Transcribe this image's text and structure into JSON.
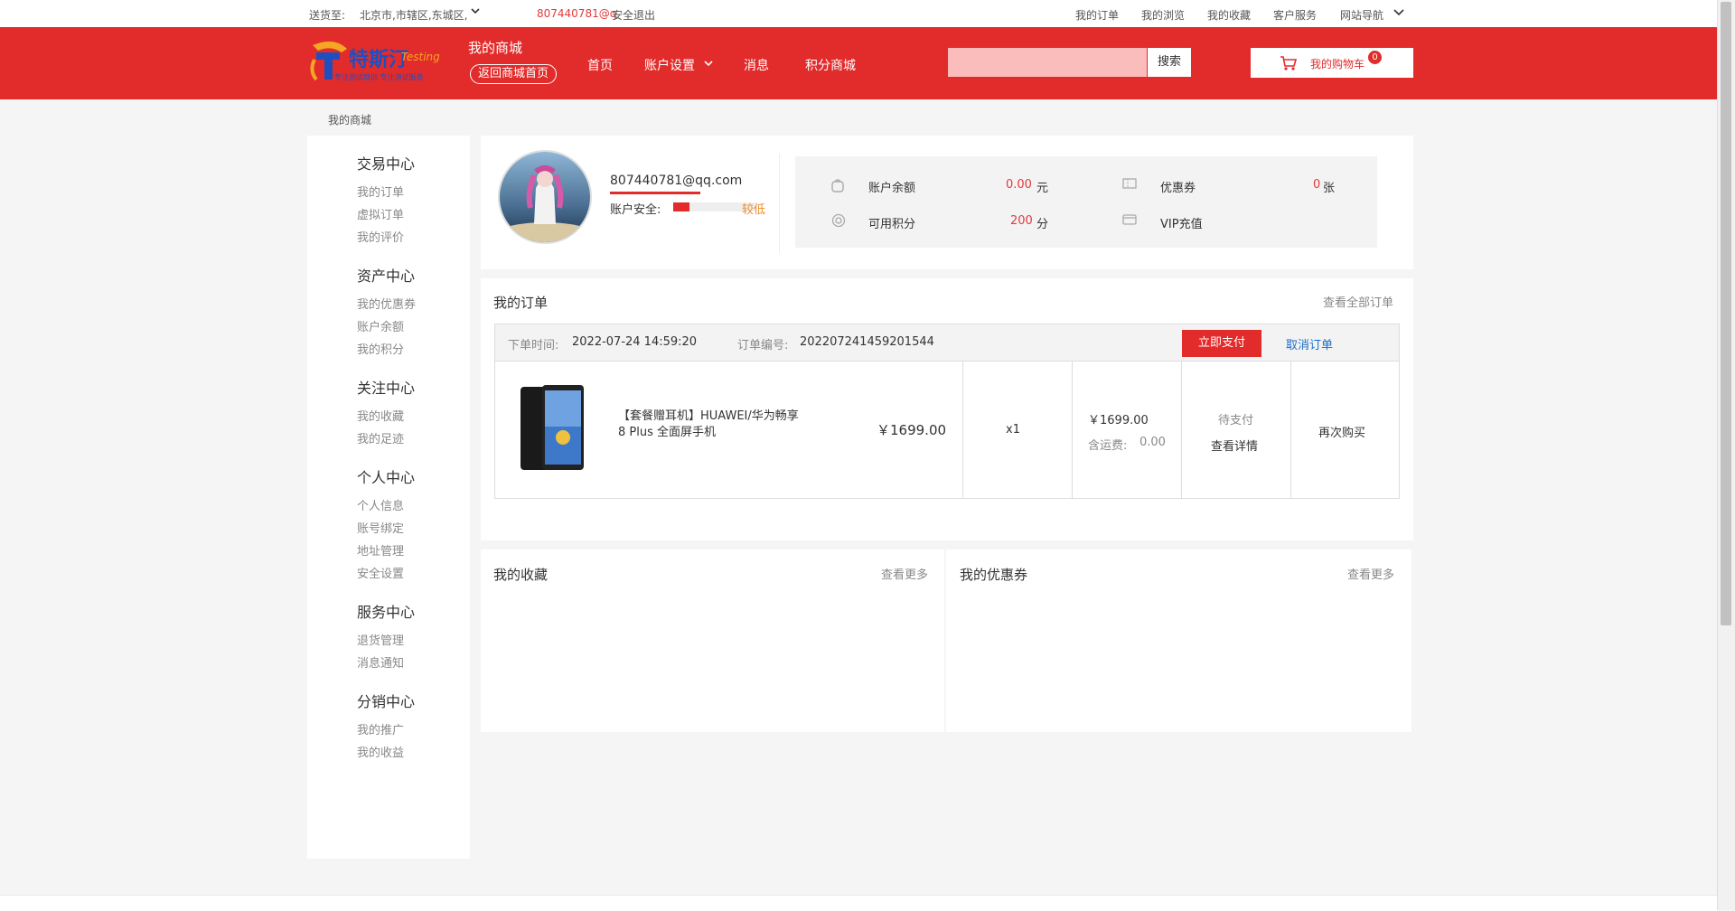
{
  "topbar": {
    "ship_to_label": "送货至:",
    "ship_to_value": "北京市,市辖区,东城区,",
    "user": "807440781@q",
    "logout": "安全退出",
    "links": [
      "我的订单",
      "我的浏览",
      "我的收藏",
      "客户服务",
      "网站导航"
    ]
  },
  "header": {
    "logo_main": "特斯汀",
    "logo_sub": "Testing",
    "logo_slogan": "专注测试培训 专注测试服务",
    "mall_title": "我的商城",
    "back_button": "返回商城首页",
    "nav": [
      "首页",
      "账户设置",
      "消息",
      "积分商城"
    ],
    "search_placeholder": "",
    "search_button": "搜索",
    "cart_label": "我的购物车",
    "cart_count": "0"
  },
  "breadcrumb": "我的商城",
  "sidebar": {
    "sections": [
      {
        "title": "交易中心",
        "items": [
          "我的订单",
          "虚拟订单",
          "我的评价"
        ]
      },
      {
        "title": "资产中心",
        "items": [
          "我的优惠券",
          "账户余额",
          "我的积分"
        ]
      },
      {
        "title": "关注中心",
        "items": [
          "我的收藏",
          "我的足迹"
        ]
      },
      {
        "title": "个人中心",
        "items": [
          "个人信息",
          "账号绑定",
          "地址管理",
          "安全设置"
        ]
      },
      {
        "title": "服务中心",
        "items": [
          "退货管理",
          "消息通知"
        ]
      },
      {
        "title": "分销中心",
        "items": [
          "我的推广",
          "我的收益"
        ]
      }
    ]
  },
  "profile": {
    "email": "807440781@qq.com",
    "security_label": "账户安全:",
    "security_level": "较低",
    "security_fraction": 0.2
  },
  "assets": {
    "balance_label": "账户余额",
    "balance_value": "0.00",
    "balance_unit": "元",
    "coupon_label": "优惠券",
    "coupon_value": "0",
    "coupon_unit": "张",
    "points_label": "可用积分",
    "points_value": "200",
    "points_unit": "分",
    "vip_label": "VIP充值"
  },
  "orders": {
    "title": "我的订单",
    "view_all": "查看全部订单",
    "order_time_label": "下单时间:",
    "order_time": "2022-07-24 14:59:20",
    "order_no_label": "订单编号:",
    "order_no": "202207241459201544",
    "pay_button": "立即支付",
    "cancel_link": "取消订单",
    "product_name": "【套餐赠耳机】HUAWEI/华为畅享8 Plus 全面屏手机",
    "unit_price": "￥1699.00",
    "quantity": "x1",
    "total": "￥1699.00",
    "shipping_label": "含运费:",
    "shipping_value": "0.00",
    "status": "待支付",
    "detail_link": "查看详情",
    "rebuy": "再次购买"
  },
  "favorites": {
    "title": "我的收藏",
    "more": "查看更多"
  },
  "coupons": {
    "title": "我的优惠券",
    "more": "查看更多"
  },
  "colors": {
    "brand_red": "#e22b2b",
    "accent_red": "#e4393c",
    "link_blue": "#1a6fc9"
  }
}
